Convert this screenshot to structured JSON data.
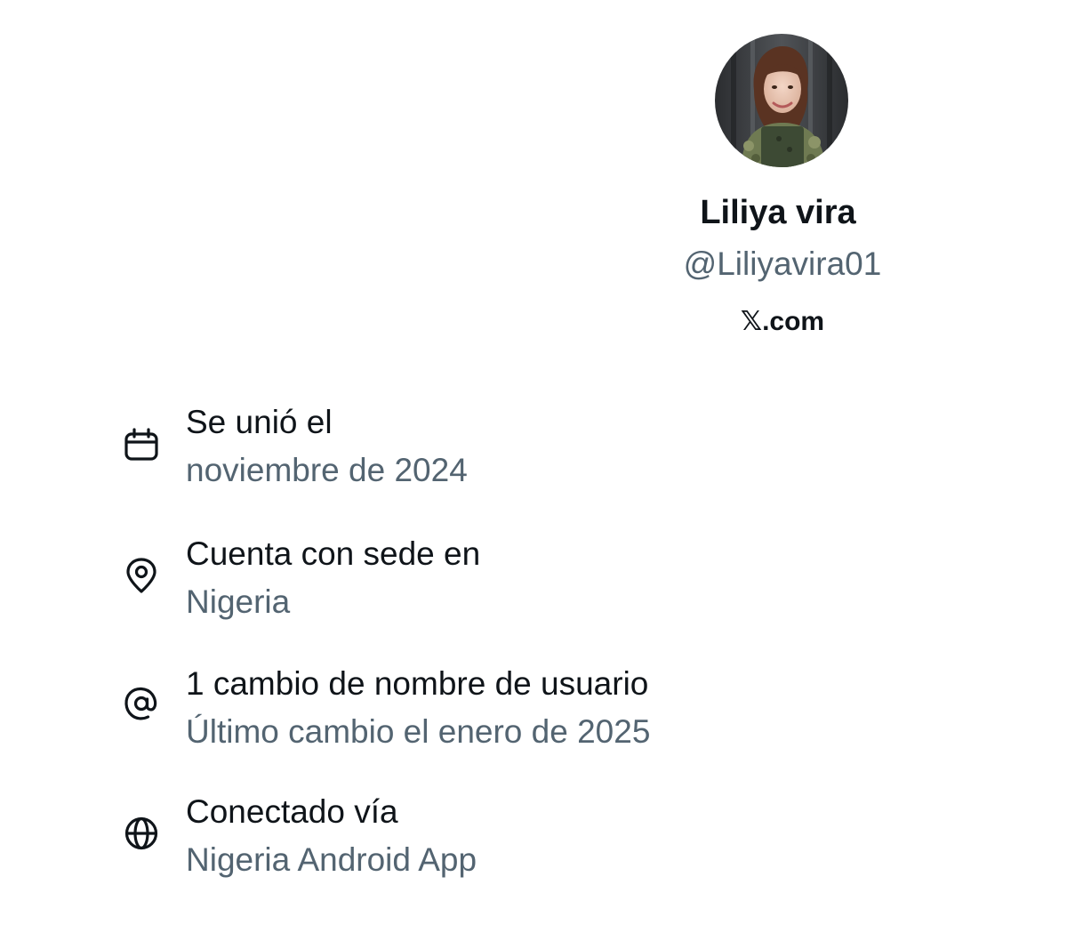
{
  "profile": {
    "display_name": "Liliya vira",
    "handle": "@Liliyavira01",
    "brand_x": "𝕏",
    "brand_domain": ".com",
    "avatar_icon": "profile-photo"
  },
  "about": [
    {
      "icon": "calendar-icon",
      "title": "Se unió el",
      "subtitle": "noviembre de 2024"
    },
    {
      "icon": "location-pin-icon",
      "title": "Cuenta con sede en",
      "subtitle": "Nigeria"
    },
    {
      "icon": "at-sign-icon",
      "title": "1 cambio de nombre de usuario",
      "subtitle": "Último cambio el enero de 2025"
    },
    {
      "icon": "globe-icon",
      "title": "Conectado vía",
      "subtitle": "Nigeria Android App"
    }
  ],
  "colors": {
    "primary_text": "#0f1419",
    "secondary_text": "#536471",
    "background": "#ffffff"
  }
}
